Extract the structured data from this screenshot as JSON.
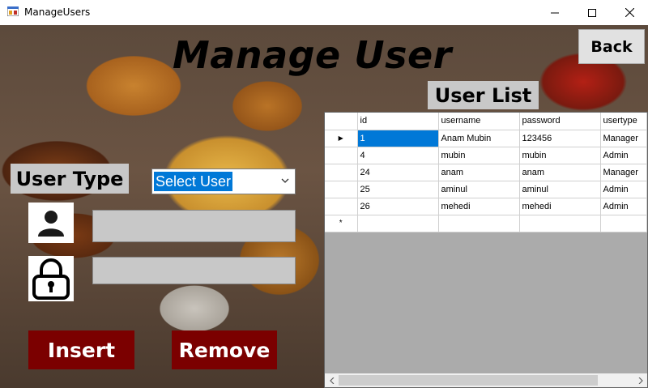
{
  "window": {
    "title": "ManageUsers",
    "minimize": "—",
    "maximize": "☐",
    "close": "✕"
  },
  "page": {
    "heading": "Manage User",
    "back_label": "Back",
    "user_list_label": "User List",
    "user_type_label": "User Type",
    "user_type_select": {
      "selected": "Select User"
    },
    "username_field": {
      "value": ""
    },
    "password_field": {
      "value": ""
    },
    "insert_label": "Insert",
    "remove_label": "Remove"
  },
  "grid": {
    "columns": [
      "id",
      "username",
      "password",
      "usertype"
    ],
    "rows": [
      {
        "id": "1",
        "username": "Anam Mubin",
        "password": "123456",
        "usertype": "Manager"
      },
      {
        "id": "4",
        "username": "mubin",
        "password": "mubin",
        "usertype": "Admin"
      },
      {
        "id": "24",
        "username": "anam",
        "password": "anam",
        "usertype": "Manager"
      },
      {
        "id": "25",
        "username": "aminul",
        "password": "aminul",
        "usertype": "Admin"
      },
      {
        "id": "26",
        "username": "mehedi",
        "password": "mehedi",
        "usertype": "Admin"
      }
    ],
    "current_row_marker": "▶",
    "new_row_marker": "*"
  },
  "colors": {
    "action_button": "#7b0000",
    "label_background": "#c8c8c8",
    "selection": "#0078d7"
  },
  "icons": [
    "app-icon",
    "user-icon",
    "lock-icon",
    "chevron-down-icon"
  ]
}
